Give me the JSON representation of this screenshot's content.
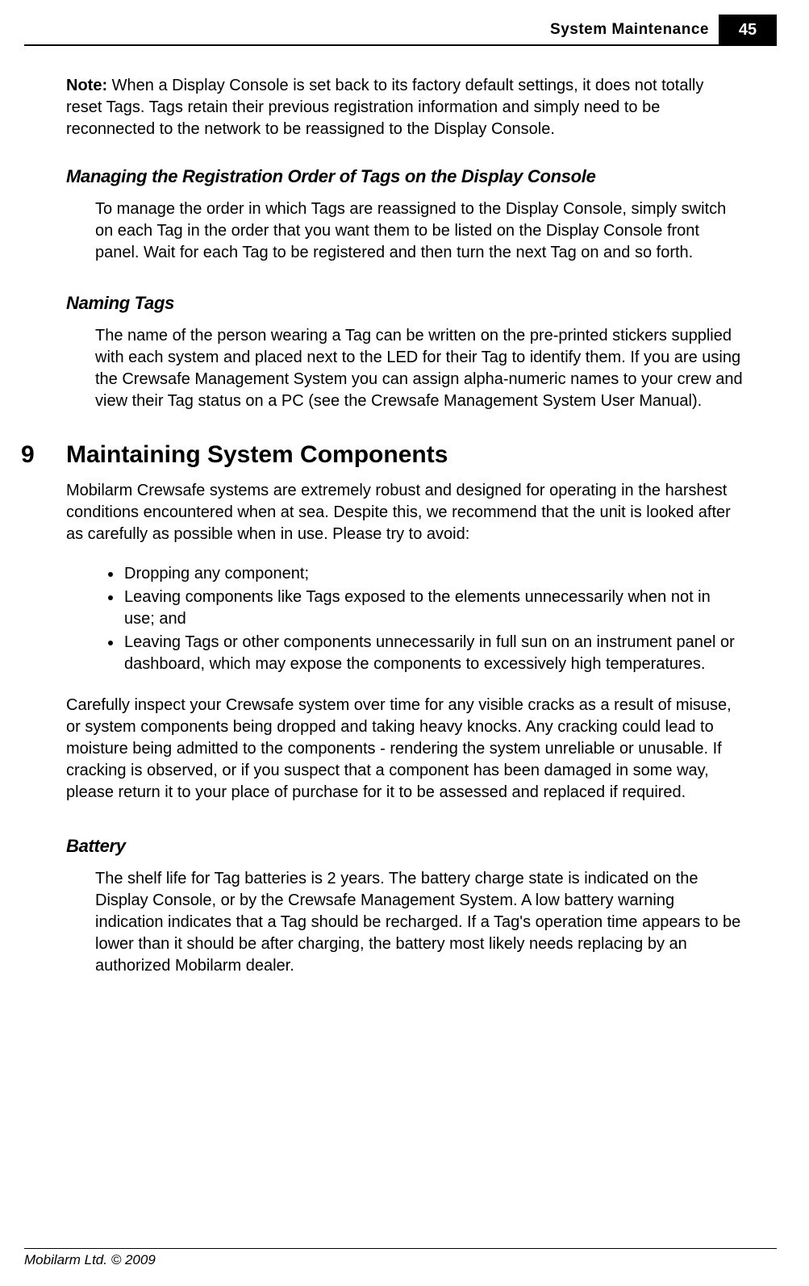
{
  "header": {
    "title": "System Maintenance",
    "page": "45"
  },
  "note": {
    "label": "Note:",
    "text": " When a Display Console is set back to its factory default settings, it does not totally reset Tags. Tags retain their previous registration information and simply need to be reconnected to the network to be reassigned to the Display Console."
  },
  "sub1": {
    "heading": "Managing the Registration Order of Tags on the Display Console",
    "body": "To manage the order in which Tags are reassigned to the Display Console, simply switch on each Tag in the order that you want them to be listed on the Display Console front panel. Wait for each Tag to be registered and then turn the next Tag on and so forth."
  },
  "sub2": {
    "heading": "Naming Tags",
    "body": "The name of the person wearing a Tag can be written on the pre-printed stickers supplied with each system and placed next to the LED for their Tag to identify them. If you are using the Crewsafe Management System you can assign alpha-numeric names to your crew and view their Tag status on a PC (see the Crewsafe Management System User Manual)."
  },
  "section9": {
    "num": "9",
    "title": "Maintaining System Components",
    "intro": "Mobilarm Crewsafe systems are extremely robust and designed for operating in the harshest conditions encountered when at sea. Despite this, we recommend that the unit is looked after as carefully as possible when in use. Please try to avoid:",
    "bullets": [
      "Dropping any component;",
      "Leaving components like Tags exposed to the elements unnecessarily when not in use; and",
      "Leaving Tags or other components unnecessarily in full sun on an instrument panel or dashboard, which may expose the components to excessively high temperatures."
    ],
    "after": "Carefully inspect your Crewsafe system over time for any visible cracks as a result of misuse, or system components being dropped and taking heavy knocks. Any cracking could lead to moisture being admitted to the components - rendering the system unreliable or unusable. If cracking is observed, or if you suspect that a component has been damaged in some way, please return it to your place of purchase for it to be assessed and replaced if required."
  },
  "sub3": {
    "heading": "Battery",
    "body": "The shelf life for Tag batteries is 2 years. The battery charge state is indicated on the Display Console, or by the Crewsafe Management System. A low battery warning indication indicates that a Tag should be recharged.  If a Tag's operation time appears to be lower than it should be after charging, the battery most likely needs replacing by an authorized Mobilarm dealer."
  },
  "footer": "Mobilarm Ltd. © 2009"
}
